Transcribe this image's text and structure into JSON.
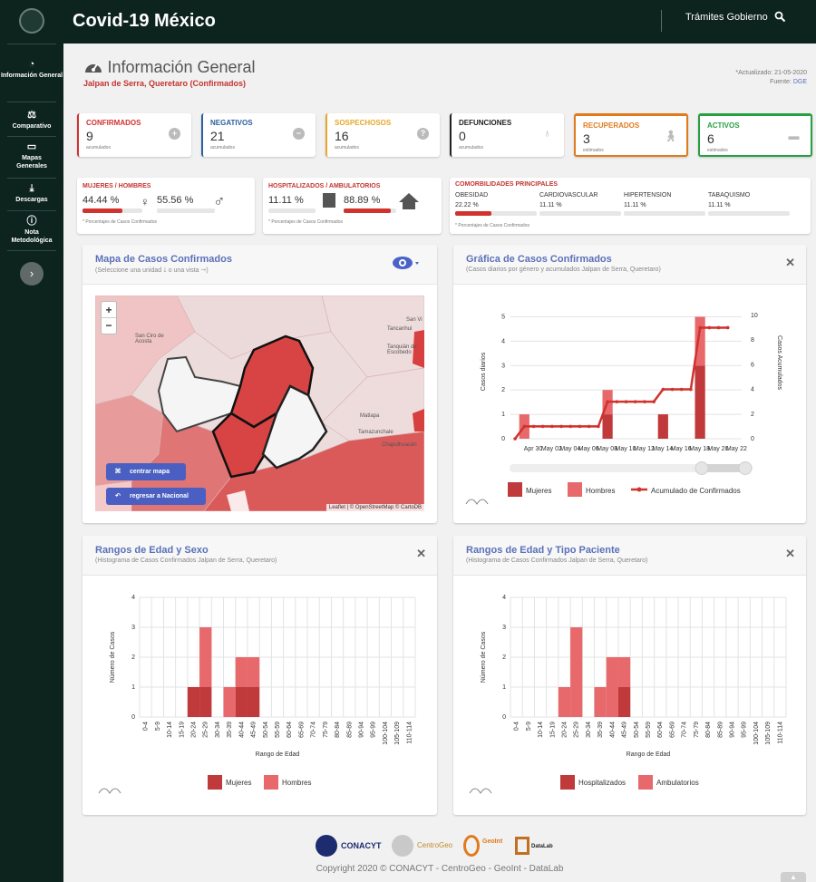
{
  "app": {
    "title": "Covid-19 México",
    "tramites": "Trámites",
    "gobierno": "Gobierno"
  },
  "sidebar": {
    "items": [
      {
        "label": "Información General",
        "icon": "dashboard-icon"
      },
      {
        "label": "Comparativo",
        "icon": "balance-icon"
      },
      {
        "label": "Mapas Generales",
        "icon": "monitor-icon"
      },
      {
        "label": "Descargas",
        "icon": "download-icon"
      },
      {
        "label": "Nota Metodológica",
        "icon": "info-icon"
      }
    ]
  },
  "header": {
    "title": "Información General",
    "subtitle": "Jalpan de Serra, Queretaro (Confirmados)",
    "updated": "*Actualizado: 21-05-2020",
    "source_label": "Fuente:",
    "source": "DGE"
  },
  "stats": [
    {
      "label": "CONFIRMADOS",
      "value": "9",
      "sub": "acumulados",
      "color": "#d0322e",
      "icon": "+"
    },
    {
      "label": "NEGATIVOS",
      "value": "21",
      "sub": "acumulados",
      "color": "#2b5f9e",
      "icon": "−"
    },
    {
      "label": "SOSPECHOSOS",
      "value": "16",
      "sub": "acumulados",
      "color": "#e6a82a",
      "icon": "?"
    },
    {
      "label": "DEFUNCIONES",
      "value": "0",
      "sub": "acumulados",
      "color": "#222222",
      "icon": "ribbon"
    },
    {
      "label": "RECUPERADOS",
      "value": "3",
      "sub": "estimados",
      "color": "#e07b1d",
      "icon": "walk"
    },
    {
      "label": "ACTIVOS",
      "value": "6",
      "sub": "estimados",
      "color": "#27a043",
      "icon": "bed"
    }
  ],
  "gender": {
    "label": "MUJERES / HOMBRES",
    "women": "44.44 %",
    "men": "55.56 %",
    "women_frac": 0.4444,
    "note": "* Porcentajes de Casos Confirmados"
  },
  "hosp": {
    "label": "HOSPITALIZADOS / AMBULATORIOS",
    "hosp": "11.11 %",
    "amb": "88.89 %",
    "amb_frac": 0.8889,
    "note": "* Porcentajes de Casos Confirmados"
  },
  "comorb": {
    "label": "COMORBILIDADES PRINCIPALES",
    "note": "* Porcentajes de Casos Confirmados",
    "items": [
      {
        "name": "OBESIDAD",
        "value": "22.22 %",
        "frac": 0.2222
      },
      {
        "name": "CARDIOVASCULAR",
        "value": "11.11 %",
        "frac": 0.1111
      },
      {
        "name": "HIPERTENSION",
        "value": "11.11 %",
        "frac": 0.1111
      },
      {
        "name": "TABAQUISMO",
        "value": "11.11 %",
        "frac": 0.1111
      }
    ]
  },
  "map": {
    "title": "Mapa de Casos Confirmados",
    "subtitle": "(Seleccione una unidad 🡓 o una vista 🡒)",
    "zoom_in": "+",
    "zoom_out": "−",
    "center_btn": "centrar mapa",
    "national_btn": "regresar a Nacional",
    "attribution": "Leaflet | © OpenStreetMap © CartoDB",
    "places": [
      "San Ciro de Acosta",
      "San Vi",
      "Tancanhui",
      "Tanquián de Escobedo",
      "Matlapa",
      "Tamazunchale",
      "Chapulhuacán"
    ]
  },
  "chart_data": [
    {
      "type": "bar",
      "title": "Gráfica de Casos Confirmados",
      "subtitle": "(Casos diarios por género y acumulados Jalpan de Serra, Queretaro)",
      "ylabel": "Casos diarios",
      "y2label": "Casos Acumulados",
      "ylim": [
        0,
        5.5
      ],
      "y2lim": [
        0,
        10
      ],
      "xticks": [
        "Apr 30",
        "May 02",
        "May 04",
        "May 06",
        "May 08",
        "May 10",
        "May 12",
        "May 14",
        "May 16",
        "May 18",
        "May 20",
        "May 22"
      ],
      "yticks": [
        0,
        1,
        2,
        3,
        4,
        5
      ],
      "y2ticks": [
        0,
        2,
        4,
        6,
        8,
        10
      ],
      "legend": [
        "Mujeres",
        "Hombres",
        "Acumulado de Confirmados"
      ],
      "bars": [
        {
          "date": "Apr 29",
          "mujeres": 0,
          "hombres": 1
        },
        {
          "date": "May 08",
          "mujeres": 1,
          "hombres": 1
        },
        {
          "date": "May 14",
          "mujeres": 1,
          "hombres": 0
        },
        {
          "date": "May 18",
          "mujeres": 3,
          "hombres": 2
        }
      ],
      "cumulative": [
        {
          "date": "Apr 28",
          "value": 0
        },
        {
          "date": "Apr 29",
          "value": 1
        },
        {
          "date": "Apr 30",
          "value": 1
        },
        {
          "date": "May 01",
          "value": 1
        },
        {
          "date": "May 02",
          "value": 1
        },
        {
          "date": "May 03",
          "value": 1
        },
        {
          "date": "May 04",
          "value": 1
        },
        {
          "date": "May 05",
          "value": 1
        },
        {
          "date": "May 06",
          "value": 1
        },
        {
          "date": "May 07",
          "value": 1
        },
        {
          "date": "May 08",
          "value": 3
        },
        {
          "date": "May 09",
          "value": 3
        },
        {
          "date": "May 10",
          "value": 3
        },
        {
          "date": "May 11",
          "value": 3
        },
        {
          "date": "May 12",
          "value": 3
        },
        {
          "date": "May 13",
          "value": 3
        },
        {
          "date": "May 14",
          "value": 4
        },
        {
          "date": "May 15",
          "value": 4
        },
        {
          "date": "May 16",
          "value": 4
        },
        {
          "date": "May 17",
          "value": 4
        },
        {
          "date": "May 18",
          "value": 9
        },
        {
          "date": "May 19",
          "value": 9
        },
        {
          "date": "May 20",
          "value": 9
        },
        {
          "date": "May 21",
          "value": 9
        }
      ]
    },
    {
      "type": "bar",
      "title": "Rangos de Edad y Sexo",
      "subtitle": "(Histograma de Casos Confirmados Jalpan de Serra, Queretaro)",
      "xlabel": "Rango de Edad",
      "ylabel": "Número de Casos",
      "ylim": [
        0,
        4
      ],
      "yticks": [
        0,
        1,
        2,
        3,
        4
      ],
      "categories": [
        "0-4",
        "5-9",
        "10-14",
        "15-19",
        "20-24",
        "25-29",
        "30-34",
        "35-39",
        "40-44",
        "45-49",
        "50-54",
        "55-59",
        "60-64",
        "65-69",
        "70-74",
        "75-79",
        "80-84",
        "85-89",
        "90-94",
        "95-99",
        "100-104",
        "105-109",
        "110-114"
      ],
      "series": [
        {
          "name": "Mujeres",
          "values": [
            0,
            0,
            0,
            0,
            1,
            1,
            0,
            0,
            1,
            1,
            0,
            0,
            0,
            0,
            0,
            0,
            0,
            0,
            0,
            0,
            0,
            0,
            0
          ]
        },
        {
          "name": "Hombres",
          "values": [
            0,
            0,
            0,
            0,
            0,
            2,
            0,
            1,
            1,
            1,
            0,
            0,
            0,
            0,
            0,
            0,
            0,
            0,
            0,
            0,
            0,
            0,
            0
          ]
        }
      ]
    },
    {
      "type": "bar",
      "title": "Rangos de Edad y Tipo Paciente",
      "subtitle": "(Histograma de Casos Confirmados Jalpan de Serra, Queretaro)",
      "xlabel": "Rango de Edad",
      "ylabel": "Número de Casos",
      "ylim": [
        0,
        4
      ],
      "yticks": [
        0,
        1,
        2,
        3,
        4
      ],
      "categories": [
        "0-4",
        "5-9",
        "10-14",
        "15-19",
        "20-24",
        "25-29",
        "30-34",
        "35-39",
        "40-44",
        "45-49",
        "50-54",
        "55-59",
        "60-64",
        "65-69",
        "70-74",
        "75-79",
        "80-84",
        "85-89",
        "90-94",
        "95-99",
        "100-104",
        "105-109",
        "110-114"
      ],
      "series": [
        {
          "name": "Hospitalizados",
          "values": [
            0,
            0,
            0,
            0,
            0,
            0,
            0,
            0,
            0,
            1,
            0,
            0,
            0,
            0,
            0,
            0,
            0,
            0,
            0,
            0,
            0,
            0,
            0
          ]
        },
        {
          "name": "Ambulatorios",
          "values": [
            0,
            0,
            0,
            0,
            1,
            3,
            0,
            1,
            2,
            1,
            0,
            0,
            0,
            0,
            0,
            0,
            0,
            0,
            0,
            0,
            0,
            0,
            0
          ]
        }
      ]
    }
  ],
  "footer": {
    "copyright": "Copyright 2020 © CONACYT - CentroGeo - GeoInt - DataLab",
    "logos": [
      "CONACYT",
      "CentroGeo",
      "GeoInt",
      "DataLab"
    ]
  },
  "colors": {
    "dark": "#0c231e",
    "accent": "#5b71b8",
    "red": "#d0322e",
    "bar_dark": "#c0393b",
    "bar_light": "#e8696b"
  }
}
